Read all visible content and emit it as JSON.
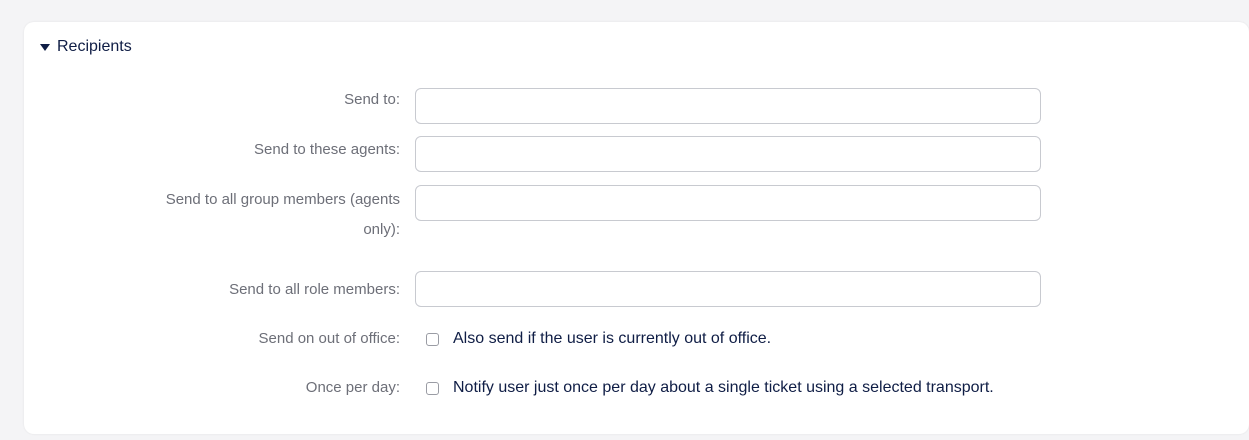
{
  "section": {
    "title": "Recipients"
  },
  "fields": {
    "send_to": {
      "label": "Send to:",
      "value": "",
      "placeholder": ""
    },
    "send_to_agents": {
      "label": "Send to these agents:",
      "value": "",
      "placeholder": ""
    },
    "send_to_group_members": {
      "label_line1": "Send to all group members (agents",
      "label_line2": "only):",
      "value": "",
      "placeholder": ""
    },
    "send_to_role_members": {
      "label": "Send to all role members:",
      "value": "",
      "placeholder": ""
    },
    "send_out_of_office": {
      "label": "Send on out of office:",
      "checkbox_label": "Also send if the user is currently out of office.",
      "checked": false
    },
    "once_per_day": {
      "label": "Once per day:",
      "checkbox_label": "Notify user just once per day about a single ticket using a selected transport.",
      "checked": false
    }
  },
  "colors": {
    "title": "#0f1d45",
    "label": "#6d6f78",
    "input_border": "#c8cad0",
    "background": "#f4f4f6",
    "panel": "#ffffff"
  },
  "icons": {
    "section_toggle": "caret-down-icon"
  }
}
